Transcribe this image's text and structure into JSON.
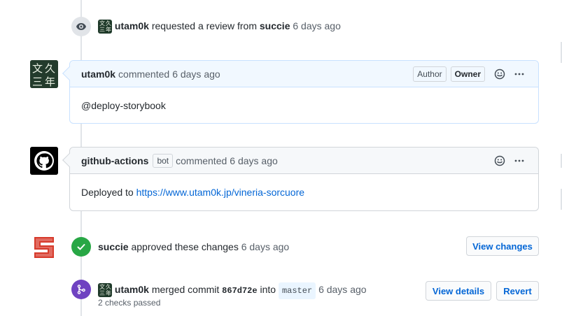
{
  "review_request": {
    "user": "utam0k",
    "text": "requested a review from",
    "reviewer": "succie",
    "time": "6 days ago",
    "icon": "eye-icon"
  },
  "comment_1": {
    "author": "utam0k",
    "action": "commented",
    "time": "6 days ago",
    "tags": [
      "Author",
      "Owner"
    ],
    "body": "@deploy-storybook"
  },
  "comment_2": {
    "author": "github-actions",
    "bot_label": "bot",
    "action": "commented",
    "time": "6 days ago",
    "body_prefix": "Deployed to",
    "body_link": "https://www.utam0k.jp/vineria-sorcuore"
  },
  "approval": {
    "user": "succie",
    "text": "approved these changes",
    "time": "6 days ago",
    "button": "View changes"
  },
  "merge": {
    "user": "utam0k",
    "text": "merged commit",
    "commit": "867d72e",
    "into": "into",
    "branch": "master",
    "time": "6 days ago",
    "checks": "2 checks passed",
    "view_details": "View details",
    "revert": "Revert"
  },
  "colors": {
    "approved": "#28a745",
    "merged": "#6f42c1",
    "link": "#0366d6",
    "succie_red": "#d73a2b"
  }
}
